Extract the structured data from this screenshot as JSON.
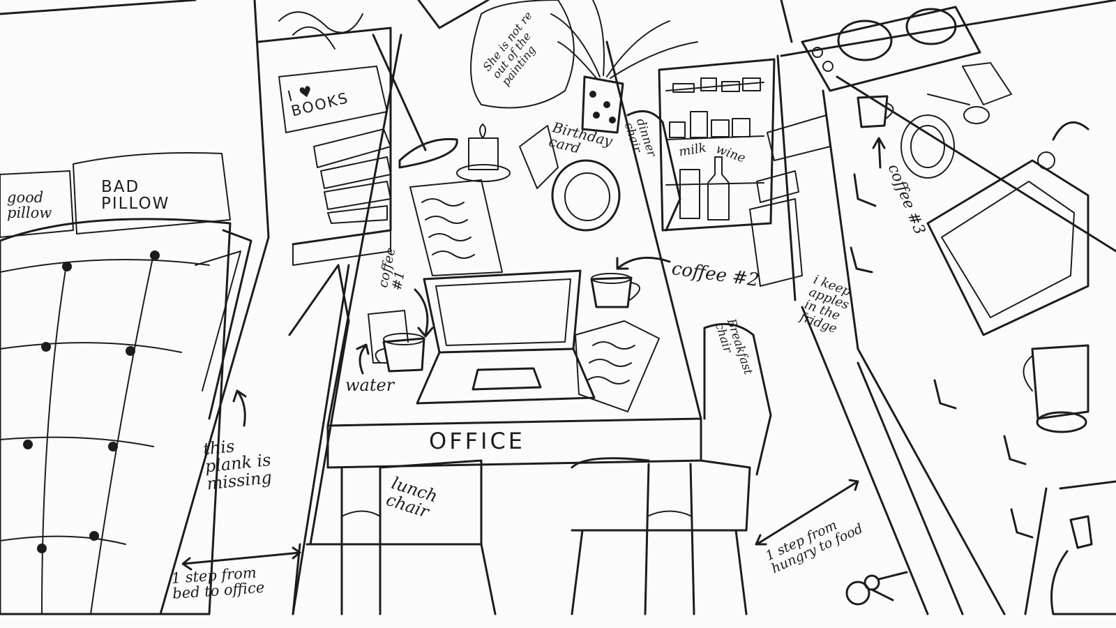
{
  "labels": {
    "good_pillow": "good\npillow",
    "bad_pillow": "BAD\nPILLOW",
    "i_love_books": "I ♥\nBOOKS",
    "painting_note": "She is not re\nout of the\npainting",
    "birthday_card": "Birthday\ncard",
    "dinner_chair": "dinner\nchair",
    "milk": "milk",
    "wine": "wine",
    "coffee_1": "coffee\n#1",
    "water": "water",
    "coffee_2": "coffee #2",
    "coffee_3": "coffee #3",
    "apples_note": "i keep\napples\nin the\nfridge",
    "breakfast_chair": "Breakfast\nchair",
    "office": "OFFICE",
    "plank_note": "this\nplank is\nmissing",
    "lunch_chair": "lunch\nchair",
    "bed_to_office": "1 step from\nbed to office",
    "hungry_to_food": "1 step from\nhungry to food"
  }
}
